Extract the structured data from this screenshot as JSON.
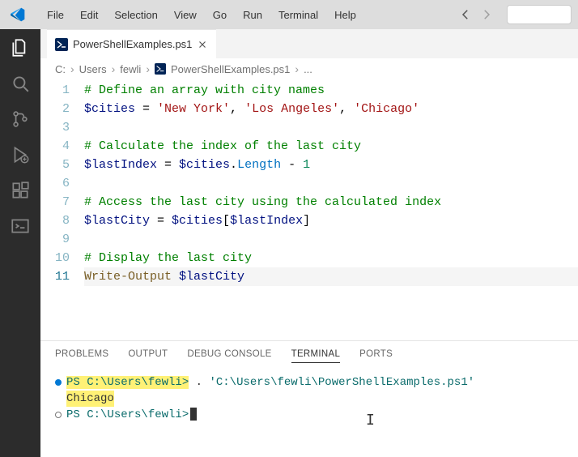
{
  "menubar": {
    "items": [
      "File",
      "Edit",
      "Selection",
      "View",
      "Go",
      "Run",
      "Terminal",
      "Help"
    ]
  },
  "tabs": [
    {
      "label": "PowerShellExamples.ps1",
      "icon": "powershell"
    }
  ],
  "breadcrumbs": {
    "items": [
      "C:",
      "Users",
      "fewli",
      "PowerShellExamples.ps1",
      "..."
    ]
  },
  "editor": {
    "lines": [
      {
        "n": 1,
        "tokens": [
          {
            "t": "# Define an array with city names",
            "c": "comment"
          }
        ]
      },
      {
        "n": 2,
        "tokens": [
          {
            "t": "$cities",
            "c": "var"
          },
          {
            "t": " = ",
            "c": "punc"
          },
          {
            "t": "'New York'",
            "c": "string"
          },
          {
            "t": ", ",
            "c": "punc"
          },
          {
            "t": "'Los Angeles'",
            "c": "string"
          },
          {
            "t": ", ",
            "c": "punc"
          },
          {
            "t": "'Chicago'",
            "c": "string"
          }
        ]
      },
      {
        "n": 3,
        "tokens": []
      },
      {
        "n": 4,
        "tokens": [
          {
            "t": "# Calculate the index of the last city",
            "c": "comment"
          }
        ]
      },
      {
        "n": 5,
        "tokens": [
          {
            "t": "$lastIndex",
            "c": "var"
          },
          {
            "t": " = ",
            "c": "punc"
          },
          {
            "t": "$cities",
            "c": "var"
          },
          {
            "t": ".",
            "c": "punc"
          },
          {
            "t": "Length",
            "c": "prop"
          },
          {
            "t": " - ",
            "c": "punc"
          },
          {
            "t": "1",
            "c": "num"
          }
        ]
      },
      {
        "n": 6,
        "tokens": []
      },
      {
        "n": 7,
        "tokens": [
          {
            "t": "# Access the last city using the calculated index",
            "c": "comment"
          }
        ]
      },
      {
        "n": 8,
        "tokens": [
          {
            "t": "$lastCity",
            "c": "var"
          },
          {
            "t": " = ",
            "c": "punc"
          },
          {
            "t": "$cities",
            "c": "var"
          },
          {
            "t": "[",
            "c": "punc"
          },
          {
            "t": "$lastIndex",
            "c": "var"
          },
          {
            "t": "]",
            "c": "punc"
          }
        ]
      },
      {
        "n": 9,
        "tokens": []
      },
      {
        "n": 10,
        "tokens": [
          {
            "t": "# Display the last city",
            "c": "comment"
          }
        ]
      },
      {
        "n": 11,
        "current": true,
        "tokens": [
          {
            "t": "Write-Output",
            "c": "cmd"
          },
          {
            "t": " ",
            "c": "punc"
          },
          {
            "t": "$lastCity",
            "c": "var"
          }
        ]
      }
    ]
  },
  "panel": {
    "tabs": [
      "PROBLEMS",
      "OUTPUT",
      "DEBUG CONSOLE",
      "TERMINAL",
      "PORTS"
    ],
    "active": "TERMINAL"
  },
  "terminal": {
    "prompt1_prefix": "PS ",
    "prompt1_path": "C:\\Users\\fewli>",
    "prompt1_cmd_dot": " . ",
    "prompt1_cmd_path": "'C:\\Users\\fewli\\PowerShellExamples.ps1'",
    "output": "Chicago",
    "prompt2_prefix": "PS ",
    "prompt2_path": "C:\\Users\\fewli>"
  }
}
